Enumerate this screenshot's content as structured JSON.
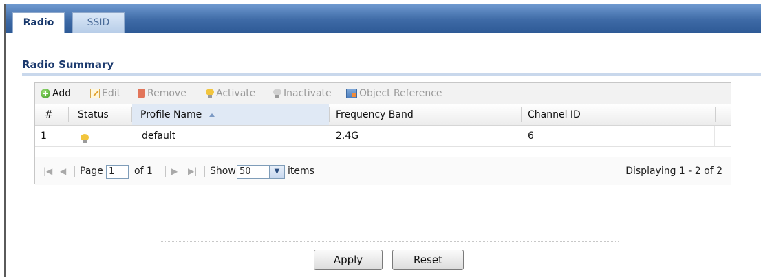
{
  "tabs": [
    {
      "label": "Radio",
      "active": true
    },
    {
      "label": "SSID",
      "active": false
    }
  ],
  "section": {
    "title": "Radio Summary"
  },
  "toolbar": {
    "add": "Add",
    "edit": "Edit",
    "remove": "Remove",
    "activate": "Activate",
    "inactivate": "Inactivate",
    "object_reference": "Object Reference"
  },
  "table": {
    "headers": [
      "#",
      "Status",
      "Profile Name",
      "Frequency Band",
      "Channel ID"
    ],
    "sorted_column": "Profile Name",
    "rows": [
      {
        "index": "1",
        "status": "active",
        "profile_name": "default",
        "frequency_band": "2.4G",
        "channel_id": "6"
      }
    ]
  },
  "pager": {
    "page_label": "Page",
    "page_value": "1",
    "of_label": "of 1",
    "show_label": "Show",
    "show_value": "50",
    "items_label": "items",
    "displaying": "Displaying 1 - 2 of 2"
  },
  "buttons": {
    "apply": "Apply",
    "reset": "Reset"
  },
  "colors": {
    "tabbar": "#3e6aa6",
    "section_title": "#1c3a6e",
    "status_on": "#f2c53d"
  }
}
